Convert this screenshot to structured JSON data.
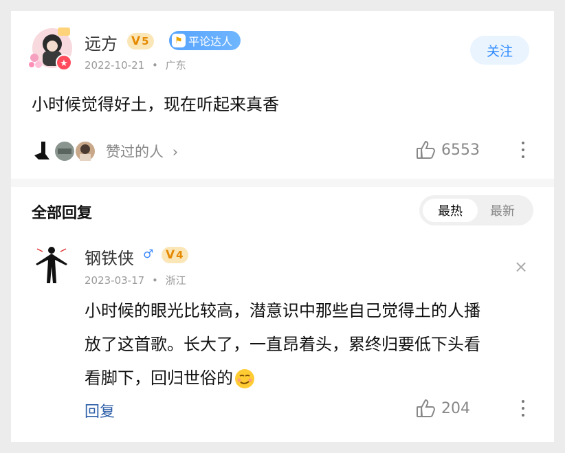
{
  "post": {
    "username": "远方",
    "level": "5",
    "badge_label": "平论达人",
    "date": "2022-10-21",
    "location": "广东",
    "follow_label": "关注",
    "content": "小时候觉得好土，现在听起来真香",
    "liked_by_label": "赞过的人",
    "like_count": "6553"
  },
  "replies_section": {
    "title": "全部回复",
    "sort_options": [
      "最热",
      "最新"
    ],
    "selected_sort": "最热"
  },
  "reply": {
    "username": "钢铁侠",
    "gender_icon": "male-icon",
    "level": "4",
    "date": "2023-03-17",
    "location": "浙江",
    "content_lines": [
      "小时候的眼光比较高，潜意识中那些自己觉得土的人播",
      "放了这首歌。长大了，一直昂着头，累终归要低下头看",
      "看脚下，回归世俗的"
    ],
    "reply_label": "回复",
    "like_count": "204"
  },
  "colors": {
    "accent": "#2f8bff",
    "level_badge": "#fbe6b8",
    "level_text": "#e58a00",
    "badge_blue": "#57a3ff"
  }
}
